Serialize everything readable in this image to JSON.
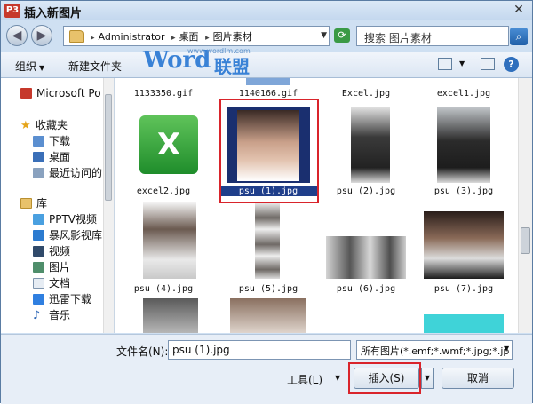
{
  "window": {
    "title": "插入新图片",
    "app_badge": "P3",
    "close_glyph": "✕"
  },
  "address": {
    "crumbs": [
      "Administrator",
      "桌面",
      "图片素材"
    ],
    "search_placeholder": "搜索 图片素材"
  },
  "toolbar": {
    "organize": "组织",
    "new_folder": "新建文件夹",
    "watermark_url": "www.wordlm.com",
    "watermark_word": "Word",
    "watermark_cn": "联盟",
    "help": "?"
  },
  "sidebar": {
    "top_item": "Microsoft Po",
    "favorites": "收藏夹",
    "fav_items": [
      "下载",
      "桌面",
      "最近访问的"
    ],
    "library": "库",
    "lib_items": [
      "PPTV视频",
      "暴风影视库",
      "视频",
      "图片",
      "文档",
      "迅雷下载",
      "音乐"
    ]
  },
  "files": {
    "row0": [
      "1133350.gif",
      "1140166.gif",
      "Excel.jpg",
      "excel1.jpg"
    ],
    "row1": [
      "excel2.jpg",
      "psu (1).jpg",
      "psu (2).jpg",
      "psu (3).jpg"
    ],
    "row2": [
      "psu (4).jpg",
      "psu (5).jpg",
      "psu (6).jpg",
      "psu (7).jpg"
    ],
    "excel_letter": "X",
    "selected": "psu (1).jpg"
  },
  "bottom": {
    "filename_label": "文件名(N):",
    "filename_value": "psu (1).jpg",
    "filetype_value": "所有图片(*.emf;*.wmf;*.jpg;*.jp",
    "tools_label": "工具(L)",
    "insert_label": "插入(S)",
    "cancel_label": "取消"
  },
  "colors": {
    "accent": "#1f3e8a",
    "highlight": "#d9242b",
    "excel_green": "#1f8d2b"
  }
}
